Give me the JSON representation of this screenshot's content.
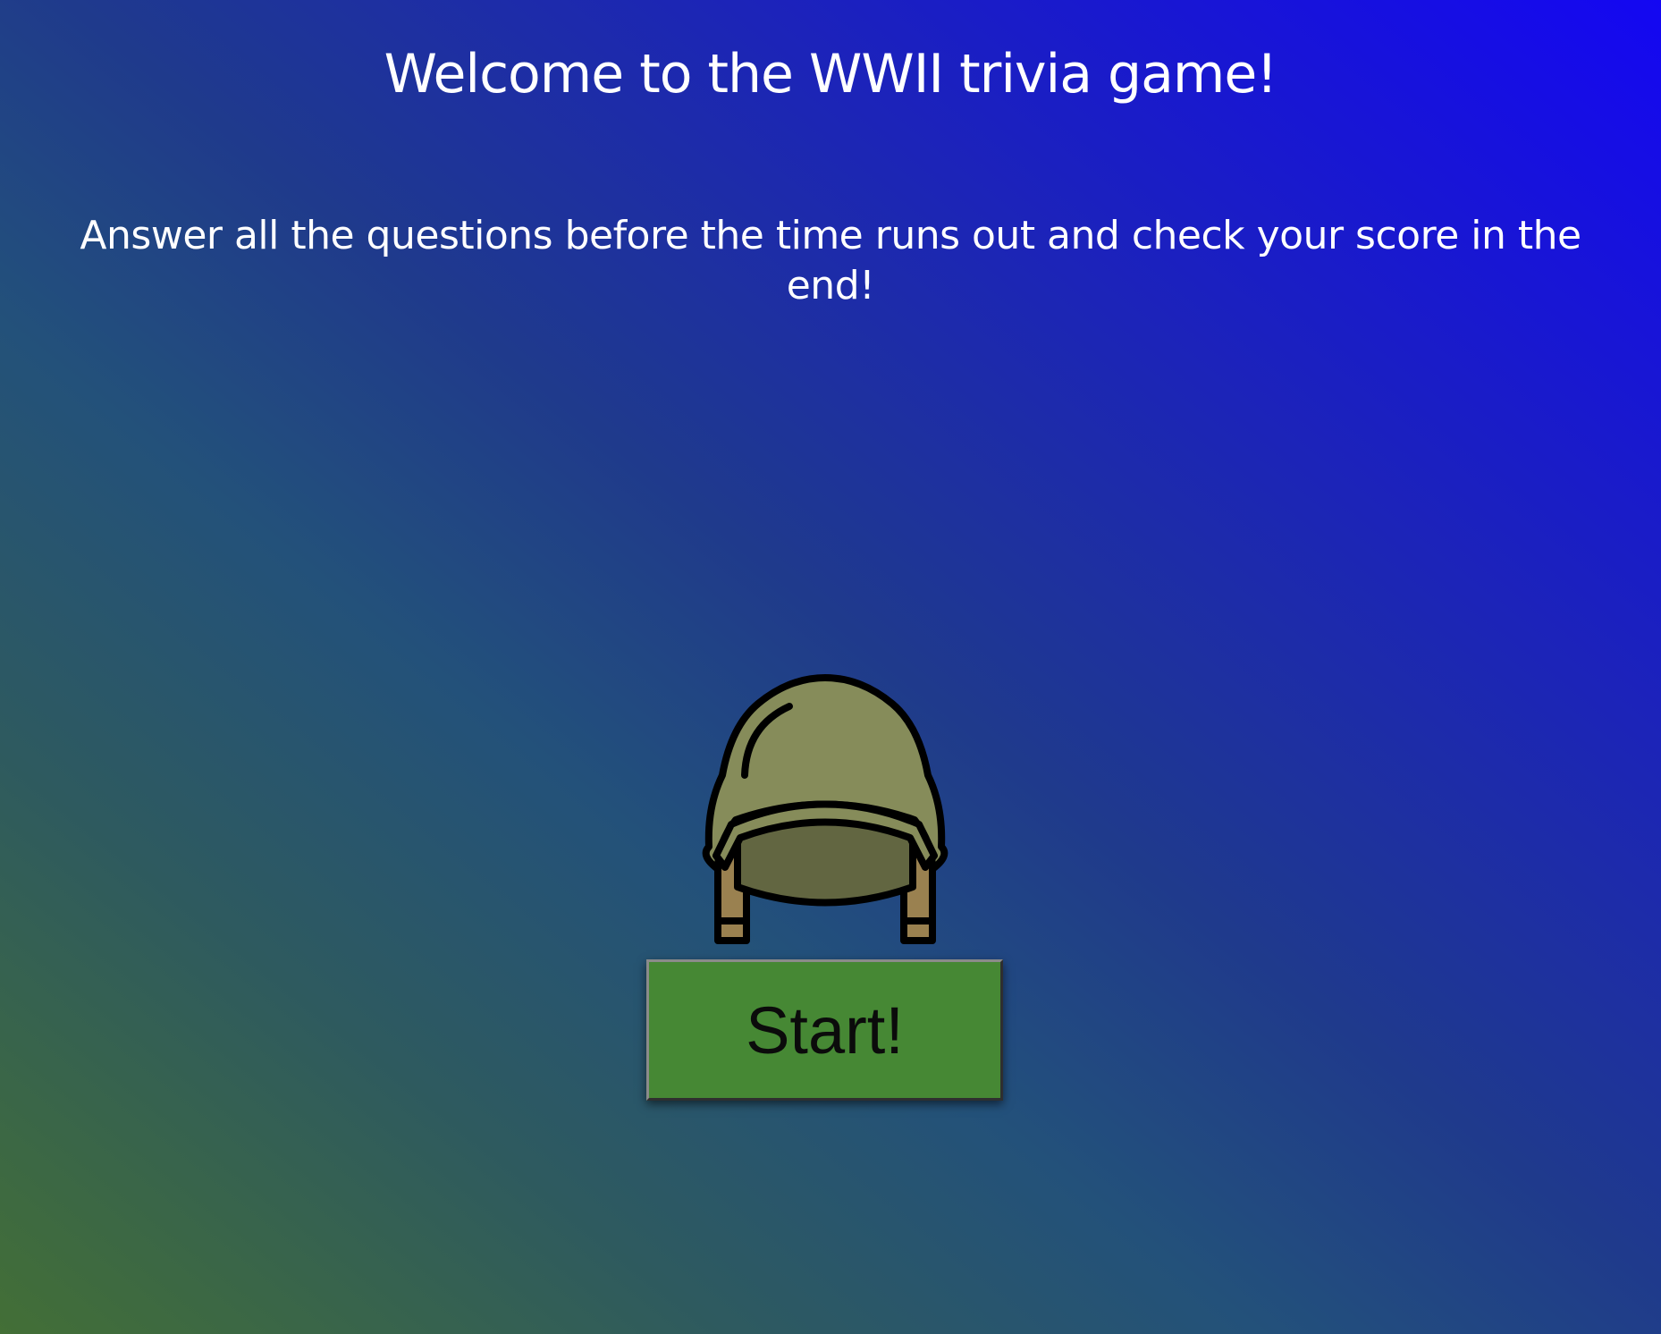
{
  "header": {
    "title": "Welcome to the WWII trivia game!",
    "subtitle": "Answer all the questions before the time runs out and check your score in the end!"
  },
  "main": {
    "image_icon": "helmet-icon",
    "start_button_label": "Start!"
  },
  "colors": {
    "background_start": "#436f36",
    "background_end": "#1407f2",
    "button_bg": "#468834",
    "helmet_shell": "#868c5a",
    "helmet_inner": "#626641",
    "helmet_straps": "#9a8150"
  }
}
